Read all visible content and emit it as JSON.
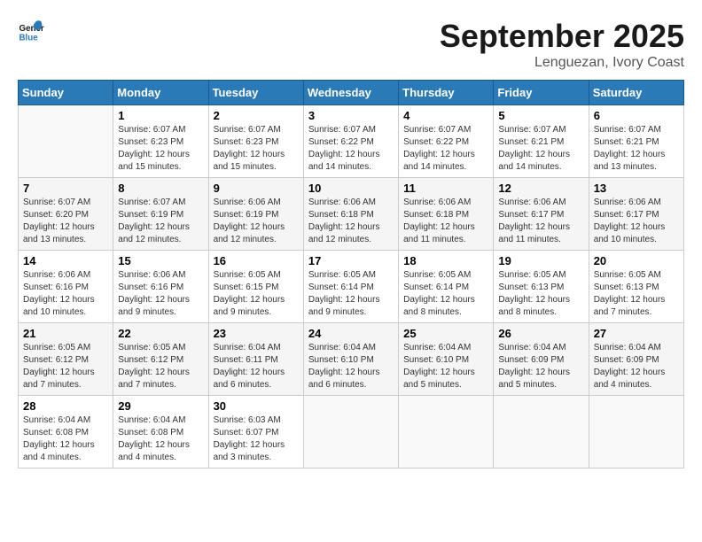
{
  "header": {
    "logo_general": "General",
    "logo_blue": "Blue",
    "month_title": "September 2025",
    "location": "Lenguezan, Ivory Coast"
  },
  "days_of_week": [
    "Sunday",
    "Monday",
    "Tuesday",
    "Wednesday",
    "Thursday",
    "Friday",
    "Saturday"
  ],
  "weeks": [
    [
      {
        "day": "",
        "sunrise": "",
        "sunset": "",
        "daylight": ""
      },
      {
        "day": "1",
        "sunrise": "Sunrise: 6:07 AM",
        "sunset": "Sunset: 6:23 PM",
        "daylight": "Daylight: 12 hours and 15 minutes."
      },
      {
        "day": "2",
        "sunrise": "Sunrise: 6:07 AM",
        "sunset": "Sunset: 6:23 PM",
        "daylight": "Daylight: 12 hours and 15 minutes."
      },
      {
        "day": "3",
        "sunrise": "Sunrise: 6:07 AM",
        "sunset": "Sunset: 6:22 PM",
        "daylight": "Daylight: 12 hours and 14 minutes."
      },
      {
        "day": "4",
        "sunrise": "Sunrise: 6:07 AM",
        "sunset": "Sunset: 6:22 PM",
        "daylight": "Daylight: 12 hours and 14 minutes."
      },
      {
        "day": "5",
        "sunrise": "Sunrise: 6:07 AM",
        "sunset": "Sunset: 6:21 PM",
        "daylight": "Daylight: 12 hours and 14 minutes."
      },
      {
        "day": "6",
        "sunrise": "Sunrise: 6:07 AM",
        "sunset": "Sunset: 6:21 PM",
        "daylight": "Daylight: 12 hours and 13 minutes."
      }
    ],
    [
      {
        "day": "7",
        "sunrise": "Sunrise: 6:07 AM",
        "sunset": "Sunset: 6:20 PM",
        "daylight": "Daylight: 12 hours and 13 minutes."
      },
      {
        "day": "8",
        "sunrise": "Sunrise: 6:07 AM",
        "sunset": "Sunset: 6:19 PM",
        "daylight": "Daylight: 12 hours and 12 minutes."
      },
      {
        "day": "9",
        "sunrise": "Sunrise: 6:06 AM",
        "sunset": "Sunset: 6:19 PM",
        "daylight": "Daylight: 12 hours and 12 minutes."
      },
      {
        "day": "10",
        "sunrise": "Sunrise: 6:06 AM",
        "sunset": "Sunset: 6:18 PM",
        "daylight": "Daylight: 12 hours and 12 minutes."
      },
      {
        "day": "11",
        "sunrise": "Sunrise: 6:06 AM",
        "sunset": "Sunset: 6:18 PM",
        "daylight": "Daylight: 12 hours and 11 minutes."
      },
      {
        "day": "12",
        "sunrise": "Sunrise: 6:06 AM",
        "sunset": "Sunset: 6:17 PM",
        "daylight": "Daylight: 12 hours and 11 minutes."
      },
      {
        "day": "13",
        "sunrise": "Sunrise: 6:06 AM",
        "sunset": "Sunset: 6:17 PM",
        "daylight": "Daylight: 12 hours and 10 minutes."
      }
    ],
    [
      {
        "day": "14",
        "sunrise": "Sunrise: 6:06 AM",
        "sunset": "Sunset: 6:16 PM",
        "daylight": "Daylight: 12 hours and 10 minutes."
      },
      {
        "day": "15",
        "sunrise": "Sunrise: 6:06 AM",
        "sunset": "Sunset: 6:16 PM",
        "daylight": "Daylight: 12 hours and 9 minutes."
      },
      {
        "day": "16",
        "sunrise": "Sunrise: 6:05 AM",
        "sunset": "Sunset: 6:15 PM",
        "daylight": "Daylight: 12 hours and 9 minutes."
      },
      {
        "day": "17",
        "sunrise": "Sunrise: 6:05 AM",
        "sunset": "Sunset: 6:14 PM",
        "daylight": "Daylight: 12 hours and 9 minutes."
      },
      {
        "day": "18",
        "sunrise": "Sunrise: 6:05 AM",
        "sunset": "Sunset: 6:14 PM",
        "daylight": "Daylight: 12 hours and 8 minutes."
      },
      {
        "day": "19",
        "sunrise": "Sunrise: 6:05 AM",
        "sunset": "Sunset: 6:13 PM",
        "daylight": "Daylight: 12 hours and 8 minutes."
      },
      {
        "day": "20",
        "sunrise": "Sunrise: 6:05 AM",
        "sunset": "Sunset: 6:13 PM",
        "daylight": "Daylight: 12 hours and 7 minutes."
      }
    ],
    [
      {
        "day": "21",
        "sunrise": "Sunrise: 6:05 AM",
        "sunset": "Sunset: 6:12 PM",
        "daylight": "Daylight: 12 hours and 7 minutes."
      },
      {
        "day": "22",
        "sunrise": "Sunrise: 6:05 AM",
        "sunset": "Sunset: 6:12 PM",
        "daylight": "Daylight: 12 hours and 7 minutes."
      },
      {
        "day": "23",
        "sunrise": "Sunrise: 6:04 AM",
        "sunset": "Sunset: 6:11 PM",
        "daylight": "Daylight: 12 hours and 6 minutes."
      },
      {
        "day": "24",
        "sunrise": "Sunrise: 6:04 AM",
        "sunset": "Sunset: 6:10 PM",
        "daylight": "Daylight: 12 hours and 6 minutes."
      },
      {
        "day": "25",
        "sunrise": "Sunrise: 6:04 AM",
        "sunset": "Sunset: 6:10 PM",
        "daylight": "Daylight: 12 hours and 5 minutes."
      },
      {
        "day": "26",
        "sunrise": "Sunrise: 6:04 AM",
        "sunset": "Sunset: 6:09 PM",
        "daylight": "Daylight: 12 hours and 5 minutes."
      },
      {
        "day": "27",
        "sunrise": "Sunrise: 6:04 AM",
        "sunset": "Sunset: 6:09 PM",
        "daylight": "Daylight: 12 hours and 4 minutes."
      }
    ],
    [
      {
        "day": "28",
        "sunrise": "Sunrise: 6:04 AM",
        "sunset": "Sunset: 6:08 PM",
        "daylight": "Daylight: 12 hours and 4 minutes."
      },
      {
        "day": "29",
        "sunrise": "Sunrise: 6:04 AM",
        "sunset": "Sunset: 6:08 PM",
        "daylight": "Daylight: 12 hours and 4 minutes."
      },
      {
        "day": "30",
        "sunrise": "Sunrise: 6:03 AM",
        "sunset": "Sunset: 6:07 PM",
        "daylight": "Daylight: 12 hours and 3 minutes."
      },
      {
        "day": "",
        "sunrise": "",
        "sunset": "",
        "daylight": ""
      },
      {
        "day": "",
        "sunrise": "",
        "sunset": "",
        "daylight": ""
      },
      {
        "day": "",
        "sunrise": "",
        "sunset": "",
        "daylight": ""
      },
      {
        "day": "",
        "sunrise": "",
        "sunset": "",
        "daylight": ""
      }
    ]
  ]
}
